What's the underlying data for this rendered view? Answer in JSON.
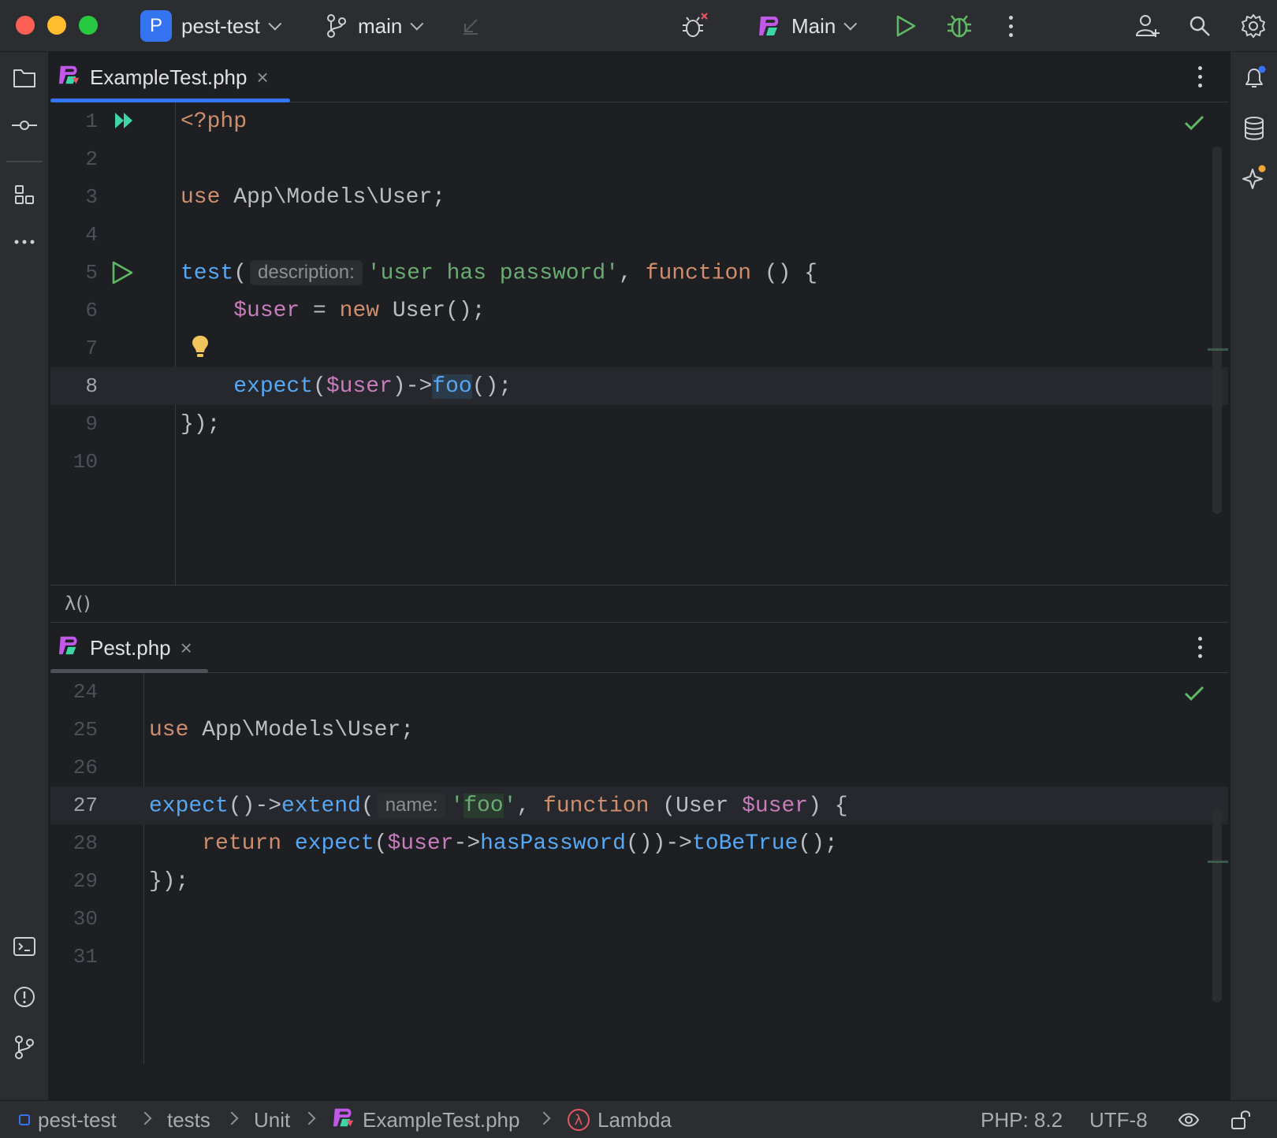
{
  "titlebar": {
    "project_initial": "P",
    "project_name": "pest-test",
    "branch": "main",
    "run_config": "Main"
  },
  "editor_top": {
    "tab_label": "ExampleTest.php",
    "tab_close": "×",
    "lines": [
      {
        "n": "1"
      },
      {
        "n": "2"
      },
      {
        "n": "3"
      },
      {
        "n": "4"
      },
      {
        "n": "5"
      },
      {
        "n": "6"
      },
      {
        "n": "7"
      },
      {
        "n": "8"
      },
      {
        "n": "9"
      },
      {
        "n": "10"
      }
    ],
    "code": {
      "l1": "<?php",
      "l3_use": "use",
      "l3_rest": " App\\Models\\User;",
      "l5_test": "test",
      "l5_paren": "(",
      "l5_hint": "description:",
      "l5_str": "'user has password'",
      "l5_comma": ", ",
      "l5_function": "function",
      "l5_rest": " () {",
      "l6_indent": "    ",
      "l6_var": "$user",
      "l6_eq": " = ",
      "l6_new": "new",
      "l6_rest": " User();",
      "l8_indent": "    ",
      "l8_expect": "expect",
      "l8_p1": "(",
      "l8_var": "$user",
      "l8_arrow": ")->",
      "l8_foo": "foo",
      "l8_end": "();",
      "l9": "});"
    },
    "breadcrumb": "λ()"
  },
  "editor_bottom": {
    "tab_label": "Pest.php",
    "tab_close": "×",
    "lines": [
      {
        "n": "24"
      },
      {
        "n": "25"
      },
      {
        "n": "26"
      },
      {
        "n": "27"
      },
      {
        "n": "28"
      },
      {
        "n": "29"
      },
      {
        "n": "30"
      },
      {
        "n": "31"
      }
    ],
    "code": {
      "l25_use": "use",
      "l25_rest": " App\\Models\\User;",
      "l27_expect": "expect",
      "l27_p": "()->",
      "l27_extend": "extend",
      "l27_paren": "(",
      "l27_hint": "name:",
      "l27_q1": "'",
      "l27_foo": "foo",
      "l27_q2": "'",
      "l27_comma": ", ",
      "l27_function": "function",
      "l27_p2": " (User ",
      "l27_var": "$user",
      "l27_end": ") {",
      "l28_indent": "    ",
      "l28_return": "return",
      "l28_sp": " ",
      "l28_expect": "expect",
      "l28_p": "(",
      "l28_var": "$user",
      "l28_arrow": "->",
      "l28_has": "hasPassword",
      "l28_mid": "())->",
      "l28_true": "toBeTrue",
      "l28_end": "();",
      "l29": "});"
    }
  },
  "statusbar": {
    "project": "pest-test",
    "folder1": "tests",
    "folder2": "Unit",
    "file": "ExampleTest.php",
    "symbol": "Lambda",
    "php_version": "PHP: 8.2",
    "encoding": "UTF-8"
  },
  "colors": {
    "accent": "#3574f0",
    "run_green": "#5fb865",
    "keyword": "#cf8e6d",
    "function": "#56a8f5",
    "string": "#6aab73",
    "variable": "#c77dbb"
  },
  "icons": [
    "folder-icon",
    "commit-icon",
    "structure-icon",
    "more-icon",
    "terminal-icon",
    "problems-icon",
    "git-icon",
    "bug-icon",
    "run-icon",
    "debug-icon",
    "add-user-icon",
    "search-icon",
    "settings-icon",
    "notifications-icon",
    "database-icon",
    "ai-assistant-icon",
    "check-icon",
    "lightbulb-icon",
    "readonly-icon",
    "lock-icon"
  ]
}
